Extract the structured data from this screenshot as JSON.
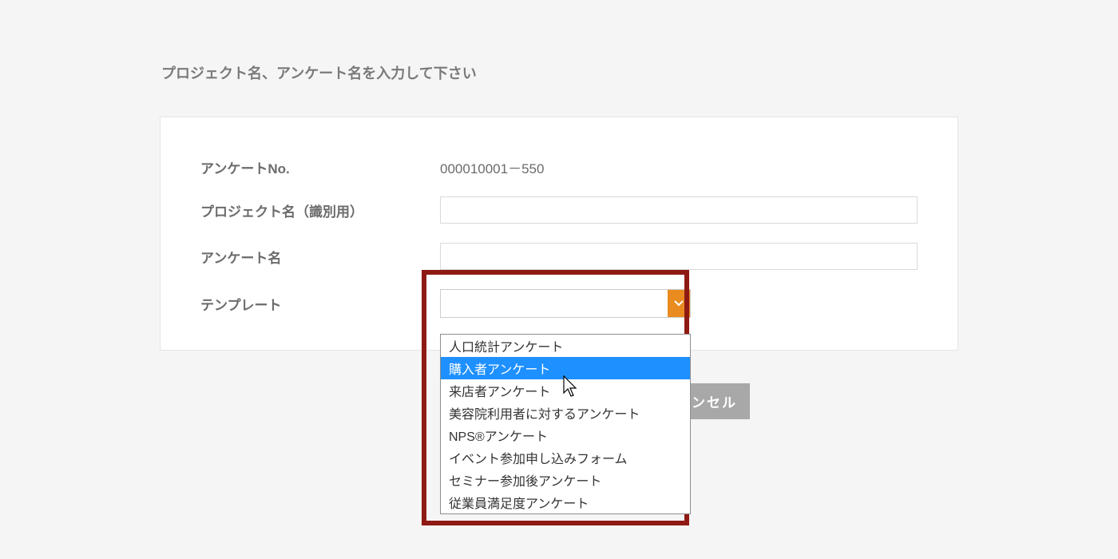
{
  "page_title": "プロジェクト名、アンケート名を入力して下さい",
  "form": {
    "survey_no_label": "アンケートNo.",
    "survey_no_value": "000010001－550",
    "project_name_label": "プロジェクト名（識別用）",
    "project_name_value": "",
    "survey_name_label": "アンケート名",
    "survey_name_value": "",
    "template_label": "テンプレート",
    "template_selected": ""
  },
  "template_options": [
    "人口統計アンケート",
    "購入者アンケート",
    "来店者アンケート",
    "美容院利用者に対するアンケート",
    "NPS®アンケート",
    "イベント参加申し込みフォーム",
    "セミナー参加後アンケート",
    "従業員満足度アンケート"
  ],
  "template_highlight_index": 1,
  "cancel_label": "ンセル",
  "colors": {
    "accent_orange": "#e98b1f",
    "highlight_blue": "#1e90ff",
    "border_red": "#8f1a14"
  }
}
